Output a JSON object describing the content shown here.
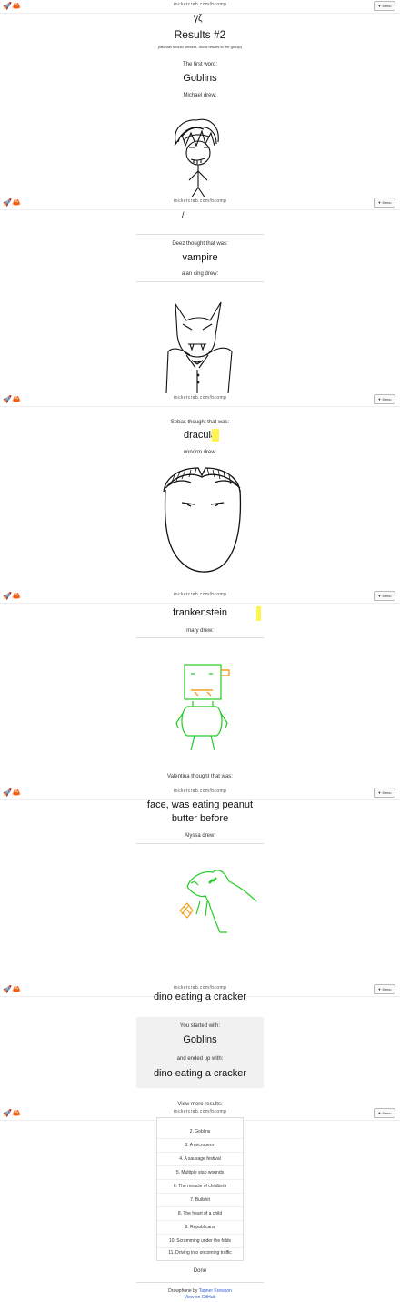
{
  "browser": {
    "url": "rocketcrab.com/bcomp",
    "menu_label": "▼ Menu",
    "icons": "🚀🦀"
  },
  "page": {
    "title": "Results #2",
    "subtitle": "(Michael should present. Show results to the group!)",
    "first_word_label": "The first word:",
    "first_word": "Goblins"
  },
  "rounds": [
    {
      "drew_label": "Michael drew:"
    },
    {
      "thought_label": "Deez thought that was:",
      "word": "vampire",
      "drew_label": "alan cing drew:"
    },
    {
      "thought_label": "Sebas thought that was:",
      "word": "dracula",
      "drew_label": "unnorm drew:"
    },
    {
      "word": "frankenstein",
      "drew_label": "mary drew:"
    },
    {
      "thought_label": "Valentina thought that was:",
      "word_line1": "face, was eating peanut",
      "word_line2": "butter before",
      "drew_label": "Alyssa drew:"
    },
    {
      "word": "dino eating a cracker"
    }
  ],
  "summary": {
    "started_label": "You started with:",
    "started_word": "Goblins",
    "ended_label": "and ended up with:",
    "ended_word": "dino eating a cracker"
  },
  "view_more_label": "View more results:",
  "results_list": [
    "2. Goblins",
    "3. A microperm",
    "4. A sausage festival",
    "5. Multiple stab wounds",
    "6. The miracle of childbirth",
    "7. Bullshit",
    "8. The heart of a child",
    "9. Republicans",
    "10. Scrumming under the folds",
    "11. Driving into oncoming traffic"
  ],
  "done_label": "Done",
  "footer": {
    "prefix": "Drawphone by",
    "author": "Tanner Krewson",
    "link2": "View on GitHub"
  },
  "colors": {
    "highlight": "#fff34d",
    "green_drawing": "#22cc22",
    "orange_drawing": "#f0a020",
    "link": "#2b5bd7"
  }
}
